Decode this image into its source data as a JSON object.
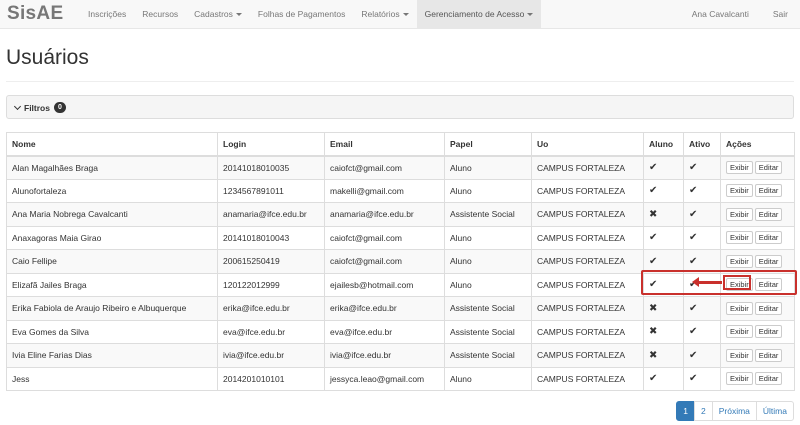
{
  "brand": "SisAE",
  "nav": {
    "items": [
      {
        "label": "Inscrições"
      },
      {
        "label": "Recursos"
      },
      {
        "label": "Cadastros"
      },
      {
        "label": "Folhas de Pagamentos"
      },
      {
        "label": "Relatórios"
      },
      {
        "label": "Gerenciamento de Acesso"
      }
    ],
    "user": "Ana Cavalcanti",
    "logout": "Sair"
  },
  "page": {
    "title": "Usuários"
  },
  "filters": {
    "label": "Filtros",
    "count": "0"
  },
  "table": {
    "headers": [
      "Nome",
      "Login",
      "Email",
      "Papel",
      "Uo",
      "Aluno",
      "Ativo",
      "Ações"
    ],
    "view_label": "Exibir",
    "edit_label": "Editar",
    "check_mark": "✔",
    "cross_mark": "✖",
    "rows": [
      {
        "nome": "Alan Magalhães Braga",
        "login": "20141018010035",
        "email": "caiofct@gmail.com",
        "papel": "Aluno",
        "uo": "CAMPUS FORTALEZA",
        "aluno": "✔",
        "ativo": "✔"
      },
      {
        "nome": "Alunofortaleza",
        "login": "1234567891011",
        "email": "makelli@gmail.com",
        "papel": "Aluno",
        "uo": "CAMPUS FORTALEZA",
        "aluno": "✔",
        "ativo": "✔"
      },
      {
        "nome": "Ana Maria Nobrega Cavalcanti",
        "login": "anamaria@ifce.edu.br",
        "email": "anamaria@ifce.edu.br",
        "papel": "Assistente Social",
        "uo": "CAMPUS FORTALEZA",
        "aluno": "✖",
        "ativo": "✔"
      },
      {
        "nome": "Anaxagoras Maia Girao",
        "login": "20141018010043",
        "email": "caiofct@gmail.com",
        "papel": "Aluno",
        "uo": "CAMPUS FORTALEZA",
        "aluno": "✔",
        "ativo": "✔"
      },
      {
        "nome": "Caio Fellipe",
        "login": "200615250419",
        "email": "caiofct@gmail.com",
        "papel": "Aluno",
        "uo": "CAMPUS FORTALEZA",
        "aluno": "✔",
        "ativo": "✔"
      },
      {
        "nome": "Elizafã Jailes Braga",
        "login": "120122012999",
        "email": "ejailesb@hotmail.com",
        "papel": "Aluno",
        "uo": "CAMPUS FORTALEZA",
        "aluno": "✔",
        "ativo": "✔"
      },
      {
        "nome": "Erika Fabiola de Araujo Ribeiro e Albuquerque",
        "login": "erika@ifce.edu.br",
        "email": "erika@ifce.edu.br",
        "papel": "Assistente Social",
        "uo": "CAMPUS FORTALEZA",
        "aluno": "✖",
        "ativo": "✔"
      },
      {
        "nome": "Eva Gomes da Silva",
        "login": "eva@ifce.edu.br",
        "email": "eva@ifce.edu.br",
        "papel": "Assistente Social",
        "uo": "CAMPUS FORTALEZA",
        "aluno": "✖",
        "ativo": "✔"
      },
      {
        "nome": "Ivia Eline Farias Dias",
        "login": "ivia@ifce.edu.br",
        "email": "ivia@ifce.edu.br",
        "papel": "Assistente Social",
        "uo": "CAMPUS FORTALEZA",
        "aluno": "✖",
        "ativo": "✔"
      },
      {
        "nome": "Jess",
        "login": "2014201010101",
        "email": "jessyca.leao@gmail.com",
        "papel": "Aluno",
        "uo": "CAMPUS FORTALEZA",
        "aluno": "✔",
        "ativo": "✔"
      }
    ]
  },
  "pagination": {
    "pages": [
      "1",
      "2"
    ],
    "current": "1",
    "next": "Próxima",
    "last": "Última"
  },
  "colors": {
    "accent": "#337ab7",
    "highlight": "#c9302c",
    "navbar": "#f8f8f8"
  }
}
